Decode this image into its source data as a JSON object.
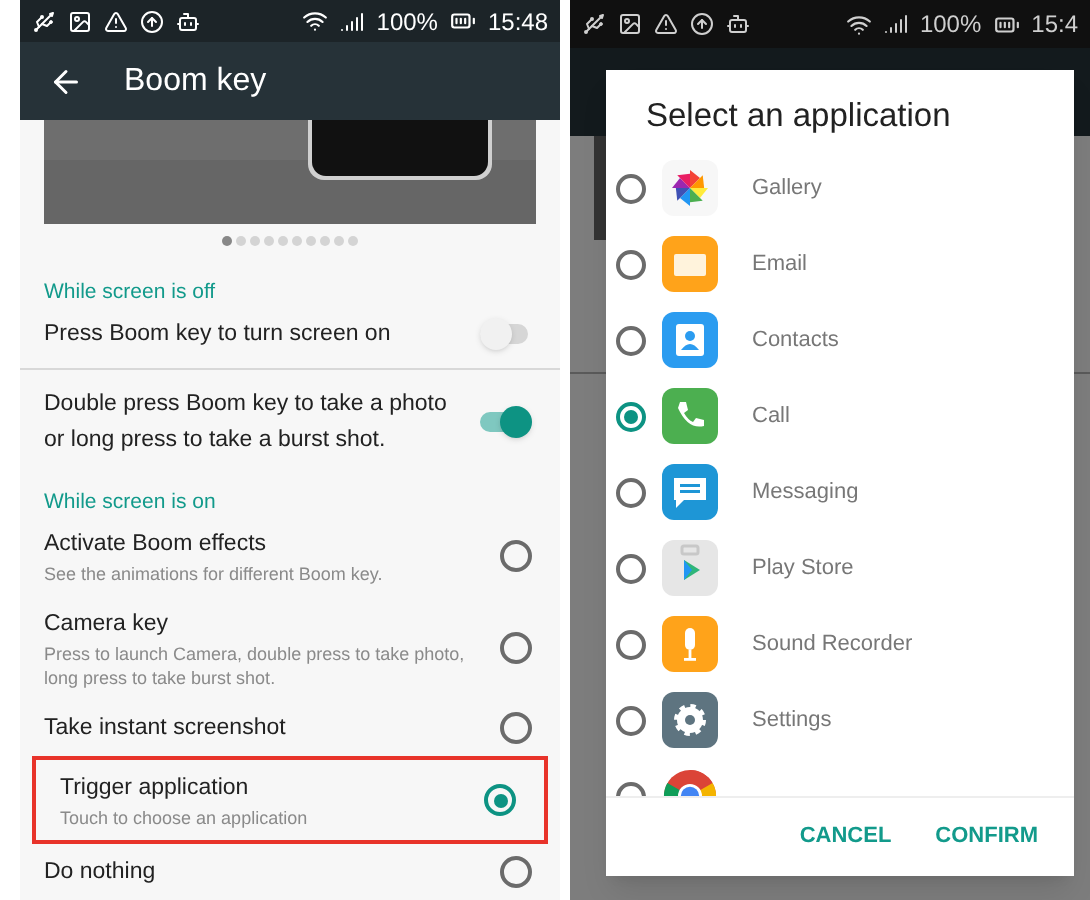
{
  "left": {
    "status_bar": {
      "battery": "100%",
      "time": "15:48"
    },
    "app_bar": {
      "title": "Boom key"
    },
    "carousel": {
      "dots": [
        {
          "selected": true
        },
        {
          "selected": false
        },
        {
          "selected": false
        },
        {
          "selected": false
        },
        {
          "selected": false
        },
        {
          "selected": false
        },
        {
          "selected": false
        },
        {
          "selected": false
        },
        {
          "selected": false
        },
        {
          "selected": false
        }
      ]
    },
    "sections": [
      {
        "header": "While screen is off",
        "items": [
          {
            "kind": "switch",
            "title": "Press Boom key to turn screen on",
            "on": false
          },
          {
            "kind": "switch",
            "title": "Double press Boom key to take a photo or long press to take a burst shot.",
            "on": true
          }
        ]
      },
      {
        "header": "While screen is on",
        "items": [
          {
            "kind": "radio",
            "title": "Activate Boom effects",
            "subtitle": "See the animations for different Boom key.",
            "selected": false,
            "highlighted": false
          },
          {
            "kind": "radio",
            "title": "Camera key",
            "subtitle": "Press to launch Camera, double press to take photo, long press to take burst shot.",
            "selected": false,
            "highlighted": false
          },
          {
            "kind": "radio",
            "title": "Take instant screenshot",
            "selected": false,
            "highlighted": false
          },
          {
            "kind": "radio",
            "title": "Trigger application",
            "subtitle": "Touch to choose an application",
            "selected": true,
            "highlighted": true
          },
          {
            "kind": "radio",
            "title": "Do nothing",
            "selected": false,
            "highlighted": false
          }
        ]
      }
    ]
  },
  "right": {
    "status_bar": {
      "battery": "100%",
      "time": "15:4"
    },
    "dialog": {
      "title": "Select an application",
      "apps": [
        {
          "kind": "gallery",
          "label": "Gallery",
          "selected": false
        },
        {
          "kind": "email",
          "label": "Email",
          "selected": false
        },
        {
          "kind": "contacts",
          "label": "Contacts",
          "selected": false
        },
        {
          "kind": "call",
          "label": "Call",
          "selected": true
        },
        {
          "kind": "messaging",
          "label": "Messaging",
          "selected": false
        },
        {
          "kind": "store",
          "label": "Play Store",
          "selected": false
        },
        {
          "kind": "recorder",
          "label": "Sound Recorder",
          "selected": false
        },
        {
          "kind": "settings",
          "label": "Settings",
          "selected": false
        },
        {
          "kind": "chrome",
          "selected": false
        }
      ],
      "buttons": [
        "CANCEL",
        "CONFIRM"
      ]
    }
  }
}
